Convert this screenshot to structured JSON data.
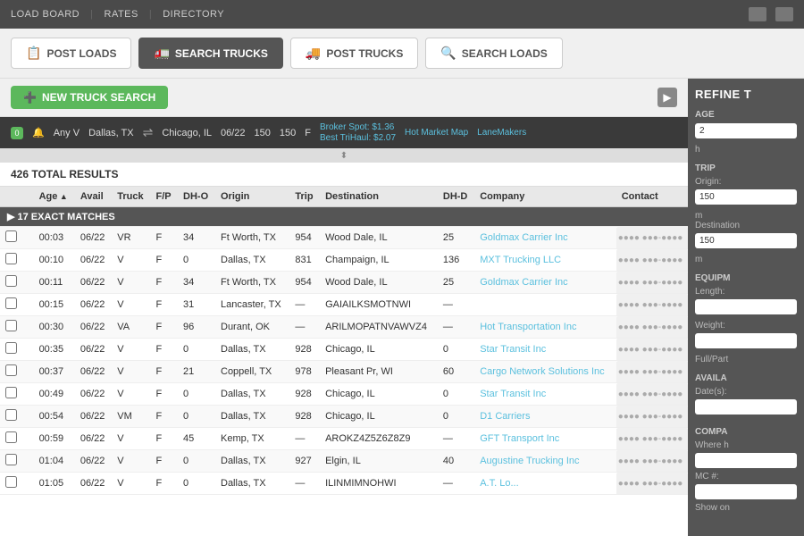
{
  "nav": {
    "items": [
      "LOAD BOARD",
      "|",
      "RATES",
      "|",
      "DIRECTORY"
    ]
  },
  "tabs": [
    {
      "id": "post-loads",
      "label": "POST LOADS",
      "icon": "📋",
      "active": false
    },
    {
      "id": "search-trucks",
      "label": "SEARCH TRUCKS",
      "icon": "🚛",
      "active": true
    },
    {
      "id": "post-trucks",
      "label": "POST TRUCKS",
      "icon": "🚚",
      "active": false
    },
    {
      "id": "search-loads",
      "label": "SEARCH LOADS",
      "icon": "🔍",
      "active": false
    }
  ],
  "search_bar": {
    "new_search_label": "NEW TRUCK SEARCH"
  },
  "search_result": {
    "type": "Any V",
    "origin": "Dallas, TX",
    "destination": "Chicago, IL",
    "date": "06/22",
    "dh_o": "150",
    "dh_d": "150",
    "fp": "F",
    "broker_spot": "Broker Spot: $1.36",
    "best_trihaul": "Best TriHaul: $2.07",
    "hot_market": "Hot Market Map",
    "lane_makers": "LaneMakers"
  },
  "results": {
    "total": "426 TOTAL RESULTS",
    "columns": [
      "",
      "",
      "Age ▲",
      "Avail",
      "Truck",
      "F/P",
      "DH-O",
      "Origin",
      "Trip",
      "Destination",
      "DH-D",
      "Company",
      "Contact"
    ],
    "exact_matches": "17 EXACT MATCHES",
    "rows": [
      {
        "age": "00:03",
        "avail": "06/22",
        "truck": "VR",
        "fp": "F",
        "dho": "34",
        "origin": "Ft Worth, TX",
        "trip": "954",
        "destination": "Wood Dale, IL",
        "dhd": "25",
        "company": "Goldmax Carrier Inc",
        "contact": "●●●● ●●●-●●●●"
      },
      {
        "age": "00:10",
        "avail": "06/22",
        "truck": "V",
        "fp": "F",
        "dho": "0",
        "origin": "Dallas, TX",
        "trip": "831",
        "destination": "Champaign, IL",
        "dhd": "136",
        "company": "MXT Trucking LLC",
        "contact": "●●●● ●●●-●●●●"
      },
      {
        "age": "00:11",
        "avail": "06/22",
        "truck": "V",
        "fp": "F",
        "dho": "34",
        "origin": "Ft Worth, TX",
        "trip": "954",
        "destination": "Wood Dale, IL",
        "dhd": "25",
        "company": "Goldmax Carrier Inc",
        "contact": "●●●● ●●●-●●●●"
      },
      {
        "age": "00:15",
        "avail": "06/22",
        "truck": "V",
        "fp": "F",
        "dho": "31",
        "origin": "Lancaster, TX",
        "trip": "—",
        "destination": "GAIAILKSMOTNWI",
        "dhd": "—",
        "company": "",
        "contact": "●●●● ●●●-●●●●"
      },
      {
        "age": "00:30",
        "avail": "06/22",
        "truck": "VA",
        "fp": "F",
        "dho": "96",
        "origin": "Durant, OK",
        "trip": "—",
        "destination": "ARILMOPATNVAWVZ4",
        "dhd": "—",
        "company": "Hot Transportation Inc",
        "contact": "●●●● ●●●-●●●●"
      },
      {
        "age": "00:35",
        "avail": "06/22",
        "truck": "V",
        "fp": "F",
        "dho": "0",
        "origin": "Dallas, TX",
        "trip": "928",
        "destination": "Chicago, IL",
        "dhd": "0",
        "company": "Star Transit Inc",
        "contact": "●●●● ●●●-●●●●"
      },
      {
        "age": "00:37",
        "avail": "06/22",
        "truck": "V",
        "fp": "F",
        "dho": "21",
        "origin": "Coppell, TX",
        "trip": "978",
        "destination": "Pleasant Pr, WI",
        "dhd": "60",
        "company": "Cargo Network Solutions Inc",
        "contact": "●●●● ●●●-●●●●"
      },
      {
        "age": "00:49",
        "avail": "06/22",
        "truck": "V",
        "fp": "F",
        "dho": "0",
        "origin": "Dallas, TX",
        "trip": "928",
        "destination": "Chicago, IL",
        "dhd": "0",
        "company": "Star Transit Inc",
        "contact": "●●●● ●●●-●●●●"
      },
      {
        "age": "00:54",
        "avail": "06/22",
        "truck": "VM",
        "fp": "F",
        "dho": "0",
        "origin": "Dallas, TX",
        "trip": "928",
        "destination": "Chicago, IL",
        "dhd": "0",
        "company": "D1 Carriers",
        "contact": "●●●● ●●●-●●●●"
      },
      {
        "age": "00:59",
        "avail": "06/22",
        "truck": "V",
        "fp": "F",
        "dho": "45",
        "origin": "Kemp, TX",
        "trip": "—",
        "destination": "AROKZ4Z5Z6Z8Z9",
        "dhd": "—",
        "company": "GFT Transport Inc",
        "contact": "●●●● ●●●-●●●●"
      },
      {
        "age": "01:04",
        "avail": "06/22",
        "truck": "V",
        "fp": "F",
        "dho": "0",
        "origin": "Dallas, TX",
        "trip": "927",
        "destination": "Elgin, IL",
        "dhd": "40",
        "company": "Augustine Trucking Inc",
        "contact": "●●●● ●●●-●●●●"
      },
      {
        "age": "01:05",
        "avail": "06/22",
        "truck": "V",
        "fp": "F",
        "dho": "0",
        "origin": "Dallas, TX",
        "trip": "—",
        "destination": "ILINMIMNOHWI",
        "dhd": "—",
        "company": "A.T. Lo...",
        "contact": "●●●● ●●●-●●●●"
      }
    ]
  },
  "refine_panel": {
    "title": "REFINE T",
    "age_label": "AGE",
    "age_value": "2",
    "age_unit": "h",
    "trip_label": "TRIP",
    "origin_label": "Origin:",
    "origin_value": "150",
    "origin_unit": "m",
    "destination_label": "Destination",
    "destination_value": "150",
    "destination_unit": "m",
    "equip_label": "EQUIPM",
    "length_label": "Length:",
    "weight_label": "Weight:",
    "fullpart_label": "Full/Part",
    "avail_label": "AVAILA",
    "dates_label": "Date(s):",
    "company_label": "COMPA",
    "where_label": "Where h",
    "mc_label": "MC #:",
    "showon_label": "Show on"
  }
}
